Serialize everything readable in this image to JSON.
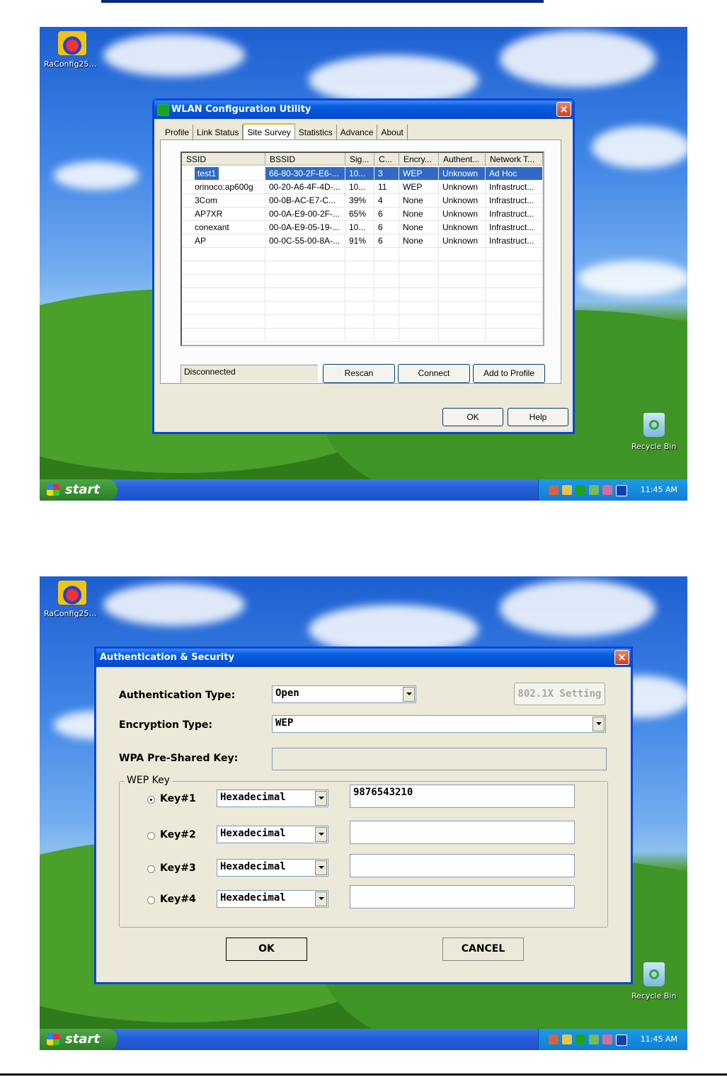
{
  "desktop_icon_label": "RaConfig25…",
  "recycle_bin_label": "Recycle Bin",
  "taskbar": {
    "start_label": "start",
    "clock": "11:45 AM"
  },
  "wlan_window": {
    "title": "WLAN Configuration Utility",
    "tabs": [
      "Profile",
      "Link Status",
      "Site Survey",
      "Statistics",
      "Advance",
      "About"
    ],
    "active_tab": "Site Survey",
    "columns": [
      "SSID",
      "BSSID",
      "Sig...",
      "C...",
      "Encry...",
      "Authent...",
      "Network T..."
    ],
    "rows": [
      [
        "test1",
        "66-80-30-2F-E6-...",
        "10...",
        "3",
        "WEP",
        "Unknown",
        "Ad Hoc"
      ],
      [
        "orinoco:ap600g",
        "00-20-A6-4F-4D-...",
        "10...",
        "11",
        "WEP",
        "Unknown",
        "Infrastruct..."
      ],
      [
        "3Com",
        "00-0B-AC-E7-C...",
        "39%",
        "4",
        "None",
        "Unknown",
        "Infrastruct..."
      ],
      [
        "AP7XR",
        "00-0A-E9-00-2F-...",
        "65%",
        "6",
        "None",
        "Unknown",
        "Infrastruct..."
      ],
      [
        "conexant",
        "00-0A-E9-05-19-...",
        "10...",
        "6",
        "None",
        "Unknown",
        "Infrastruct..."
      ],
      [
        "AP",
        "00-0C-55-00-8A-...",
        "91%",
        "6",
        "None",
        "Unknown",
        "Infrastruct..."
      ]
    ],
    "status": "Disconnected",
    "buttons": {
      "rescan": "Rescan",
      "connect": "Connect",
      "add_to_profile": "Add to Profile",
      "ok": "OK",
      "help": "Help"
    }
  },
  "auth_dialog": {
    "title": "Authentication & Security",
    "auth_type_label": "Authentication Type:",
    "auth_type_value": "Open",
    "setting_button": "802.1X Setting",
    "encryption_label": "Encryption Type:",
    "encryption_value": "WEP",
    "wpa_label": "WPA Pre-Shared Key:",
    "wpa_value": "",
    "wep_group_label": "WEP Key",
    "keys": [
      {
        "label": "Key#1",
        "format": "Hexadecimal",
        "value": "9876543210",
        "selected": true
      },
      {
        "label": "Key#2",
        "format": "Hexadecimal",
        "value": "",
        "selected": false
      },
      {
        "label": "Key#3",
        "format": "Hexadecimal",
        "value": "",
        "selected": false
      },
      {
        "label": "Key#4",
        "format": "Hexadecimal",
        "value": "",
        "selected": false
      }
    ],
    "ok": "OK",
    "cancel": "CANCEL"
  }
}
